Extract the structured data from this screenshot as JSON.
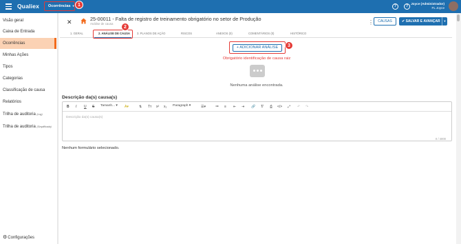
{
  "topbar": {
    "logo": "Qualiex",
    "module_button": "Ocorrências",
    "user_name": "Joyce (Administrador)",
    "user_unit": "FL Joyce",
    "badges": [
      "1",
      "2",
      "3"
    ]
  },
  "sidebar": {
    "items": [
      {
        "label": "Visão geral",
        "suffix": ""
      },
      {
        "label": "Caixa de Entrada",
        "suffix": ""
      },
      {
        "label": "Ocorrências",
        "suffix": ""
      },
      {
        "label": "Minhas Ações",
        "suffix": ""
      },
      {
        "label": "Tipos",
        "suffix": ""
      },
      {
        "label": "Categorias",
        "suffix": ""
      },
      {
        "label": "Classificação de causa",
        "suffix": ""
      },
      {
        "label": "Relatórios",
        "suffix": ""
      },
      {
        "label": "Trilha de auditoria",
        "suffix": "(Log)"
      },
      {
        "label": "Trilha de auditoria",
        "suffix": "(Simplificada)"
      }
    ],
    "settings": "Configurações"
  },
  "record": {
    "title": "25-00011 - Falta de registro de treinamento obrigatório no setor de Produção",
    "subtitle": "Análise de causa",
    "causas_button": "CAUSAS",
    "save_button": "SALVAR E AVANÇAR"
  },
  "tabs": [
    "1. GERAL",
    "2. ANÁLISE DE CAUSA",
    "3. PLANOS DE AÇÃO",
    "RISCOS",
    "ANEXOS (0)",
    "COMENTÁRIOS (0)",
    "HISTÓRICO"
  ],
  "analysis": {
    "add_button": "+ ADICIONAR ANÁLISE",
    "required_message": "Obrigatório identificação de causa raiz",
    "empty_message": "Nenhuma análise encontrada."
  },
  "description": {
    "label": "Descrição da(s) causa(s)",
    "placeholder": "Descrição da(s) causa(s)",
    "counter": "0 / 4000",
    "size_select": "Tamanh...",
    "format_select": "Paragraph"
  },
  "form_message": "Nenhum formulário selecionado.",
  "colors": {
    "primary": "#1e6fb0",
    "accent": "#f26a1b",
    "highlight": "#e53935"
  }
}
